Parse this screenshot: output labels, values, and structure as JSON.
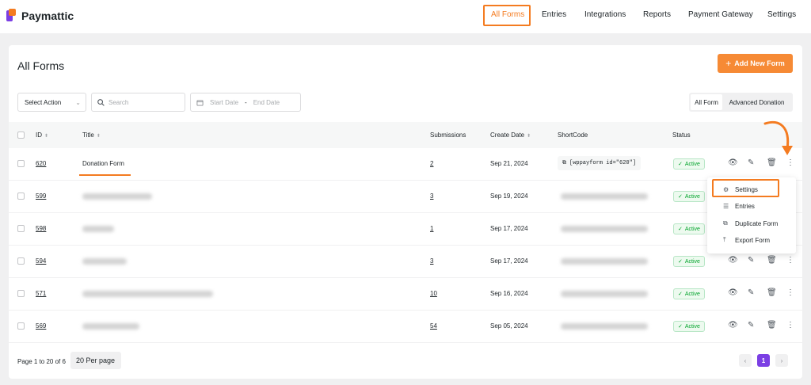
{
  "brand": {
    "name": "Paymattic"
  },
  "nav": {
    "items": [
      {
        "label": "All Forms"
      },
      {
        "label": "Entries"
      },
      {
        "label": "Integrations"
      },
      {
        "label": "Reports"
      },
      {
        "label": "Payment Gateway"
      },
      {
        "label": "Settings"
      }
    ]
  },
  "page": {
    "title": "All Forms",
    "add_button": "Add New Form"
  },
  "filters": {
    "action_select": "Select Action",
    "search_placeholder": "Search",
    "start_date": "Start Date",
    "date_sep": "-",
    "end_date": "End Date",
    "tabs": [
      "All Form",
      "Advanced Donation"
    ]
  },
  "table": {
    "headers": {
      "id": "ID",
      "title": "Title",
      "submissions": "Submissions",
      "create_date": "Create Date",
      "shortcode": "ShortCode",
      "status": "Status"
    },
    "rows": [
      {
        "id": "620",
        "title": "Donation Form",
        "submissions": "2",
        "date": "Sep 21, 2024",
        "shortcode": "[wppayform id=\"620\"]",
        "status": "Active"
      },
      {
        "id": "599",
        "title": "",
        "submissions": "3",
        "date": "Sep 19, 2024",
        "shortcode": "",
        "status": "Active"
      },
      {
        "id": "598",
        "title": "",
        "submissions": "1",
        "date": "Sep 17, 2024",
        "shortcode": "",
        "status": "Active"
      },
      {
        "id": "594",
        "title": "",
        "submissions": "3",
        "date": "Sep 17, 2024",
        "shortcode": "",
        "status": "Active"
      },
      {
        "id": "571",
        "title": "",
        "submissions": "10",
        "date": "Sep 16, 2024",
        "shortcode": "",
        "status": "Active"
      },
      {
        "id": "569",
        "title": "",
        "submissions": "54",
        "date": "Sep 05, 2024",
        "shortcode": "",
        "status": "Active"
      }
    ]
  },
  "menu": {
    "items": [
      "Settings",
      "Entries",
      "Duplicate Form",
      "Export Form"
    ]
  },
  "footer": {
    "page_info": "Page 1 to 20 of 6",
    "per_page": "20 Per page",
    "current_page": "1"
  },
  "colors": {
    "accent": "#f47b20",
    "brand_purple": "#7b3fe4",
    "active_green": "#00a32a"
  }
}
